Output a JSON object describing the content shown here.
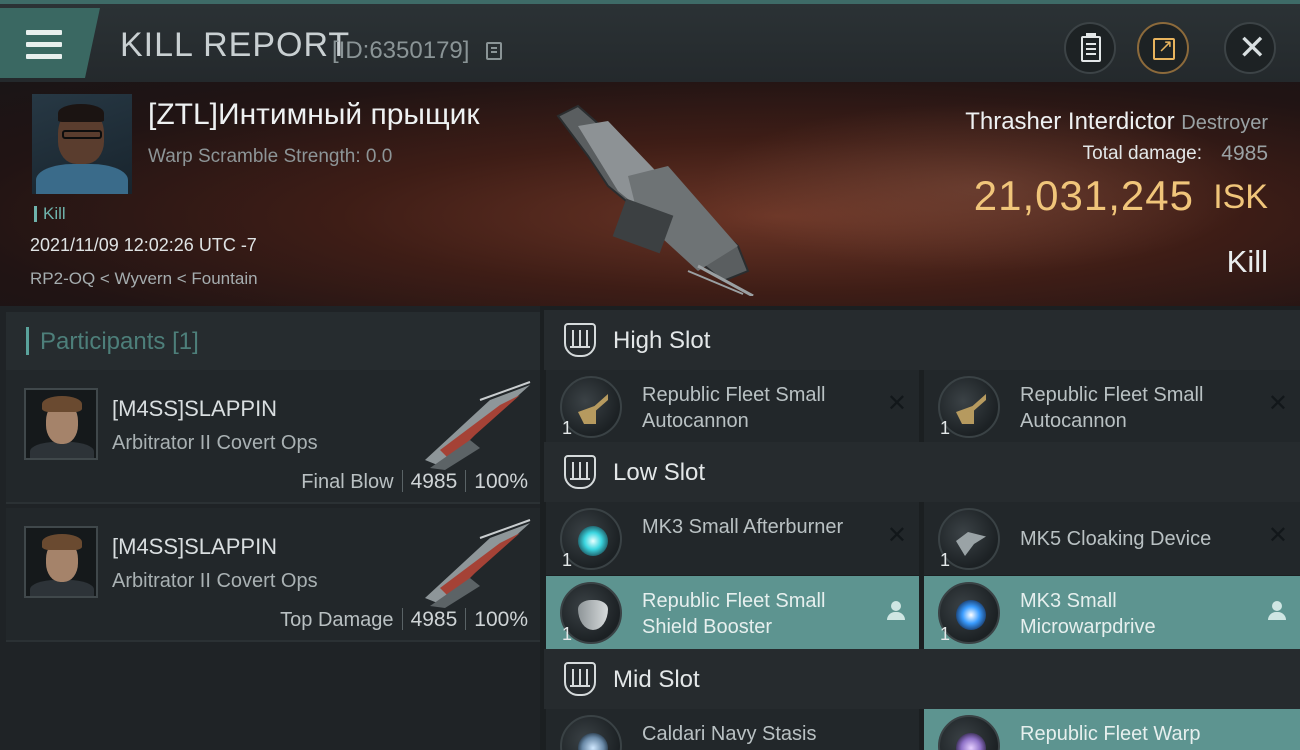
{
  "header": {
    "title": "KILL REPORT",
    "kill_id": "[ID:6350179]",
    "icons": {
      "menu": "hamburger-icon",
      "copy": "copy-icon",
      "clipboard": "clipboard-icon",
      "share": "share-icon",
      "close": "close-icon"
    }
  },
  "victim": {
    "name": "[ZTL]Интимный прыщик",
    "warp_strength": "Warp Scramble Strength: 0.0",
    "kill_tag": "Kill",
    "datetime": "2021/11/09 12:02:26 UTC -7",
    "location": "RP2-OQ < Wyvern < Fountain",
    "ship_name": "Thrasher Interdictor",
    "ship_class": "Destroyer",
    "total_damage_label": "Total damage:",
    "total_damage": "4985",
    "isk_value": "21,031,245",
    "isk_unit": "ISK",
    "type": "Kill"
  },
  "participants": {
    "title": "Participants",
    "count": "[1]",
    "rows": [
      {
        "name": "[M4SS]SLAPPIN",
        "ship": "Arbitrator II Covert Ops",
        "tag": "Final Blow",
        "damage": "4985",
        "percent": "100%"
      },
      {
        "name": "[M4SS]SLAPPIN",
        "ship": "Arbitrator II Covert Ops",
        "tag": "Top Damage",
        "damage": "4985",
        "percent": "100%"
      }
    ]
  },
  "slots": {
    "high": {
      "title": "High Slot",
      "modules": [
        {
          "name": "Republic Fleet Small Autocannon",
          "qty": "1",
          "status": "destroyed",
          "icon": "autocannon-icon"
        },
        {
          "name": "Republic Fleet Small Autocannon",
          "qty": "1",
          "status": "destroyed",
          "icon": "autocannon-icon"
        }
      ]
    },
    "low": {
      "title": "Low Slot",
      "modules": [
        {
          "name": "MK3 Small Afterburner",
          "qty": "1",
          "status": "destroyed",
          "icon": "afterburner-icon"
        },
        {
          "name": "MK5 Cloaking Device",
          "qty": "1",
          "status": "destroyed",
          "icon": "cloaking-device-icon"
        },
        {
          "name": "Republic Fleet Small Shield Booster",
          "qty": "1",
          "status": "dropped",
          "icon": "shield-booster-icon"
        },
        {
          "name": "MK3 Small Microwarpdrive",
          "qty": "1",
          "status": "dropped",
          "icon": "microwarpdrive-icon"
        }
      ]
    },
    "mid": {
      "title": "Mid Slot",
      "modules": [
        {
          "name": "Caldari Navy Stasis",
          "qty": "",
          "status": "destroyed",
          "icon": "stasis-webifier-icon"
        },
        {
          "name": "Republic Fleet Warp",
          "qty": "",
          "status": "dropped",
          "icon": "warp-disruptor-icon"
        }
      ]
    }
  },
  "colors": {
    "accent_teal": "#5d9490",
    "isk_gold": "#f0c57a",
    "background": "#1e2225"
  }
}
